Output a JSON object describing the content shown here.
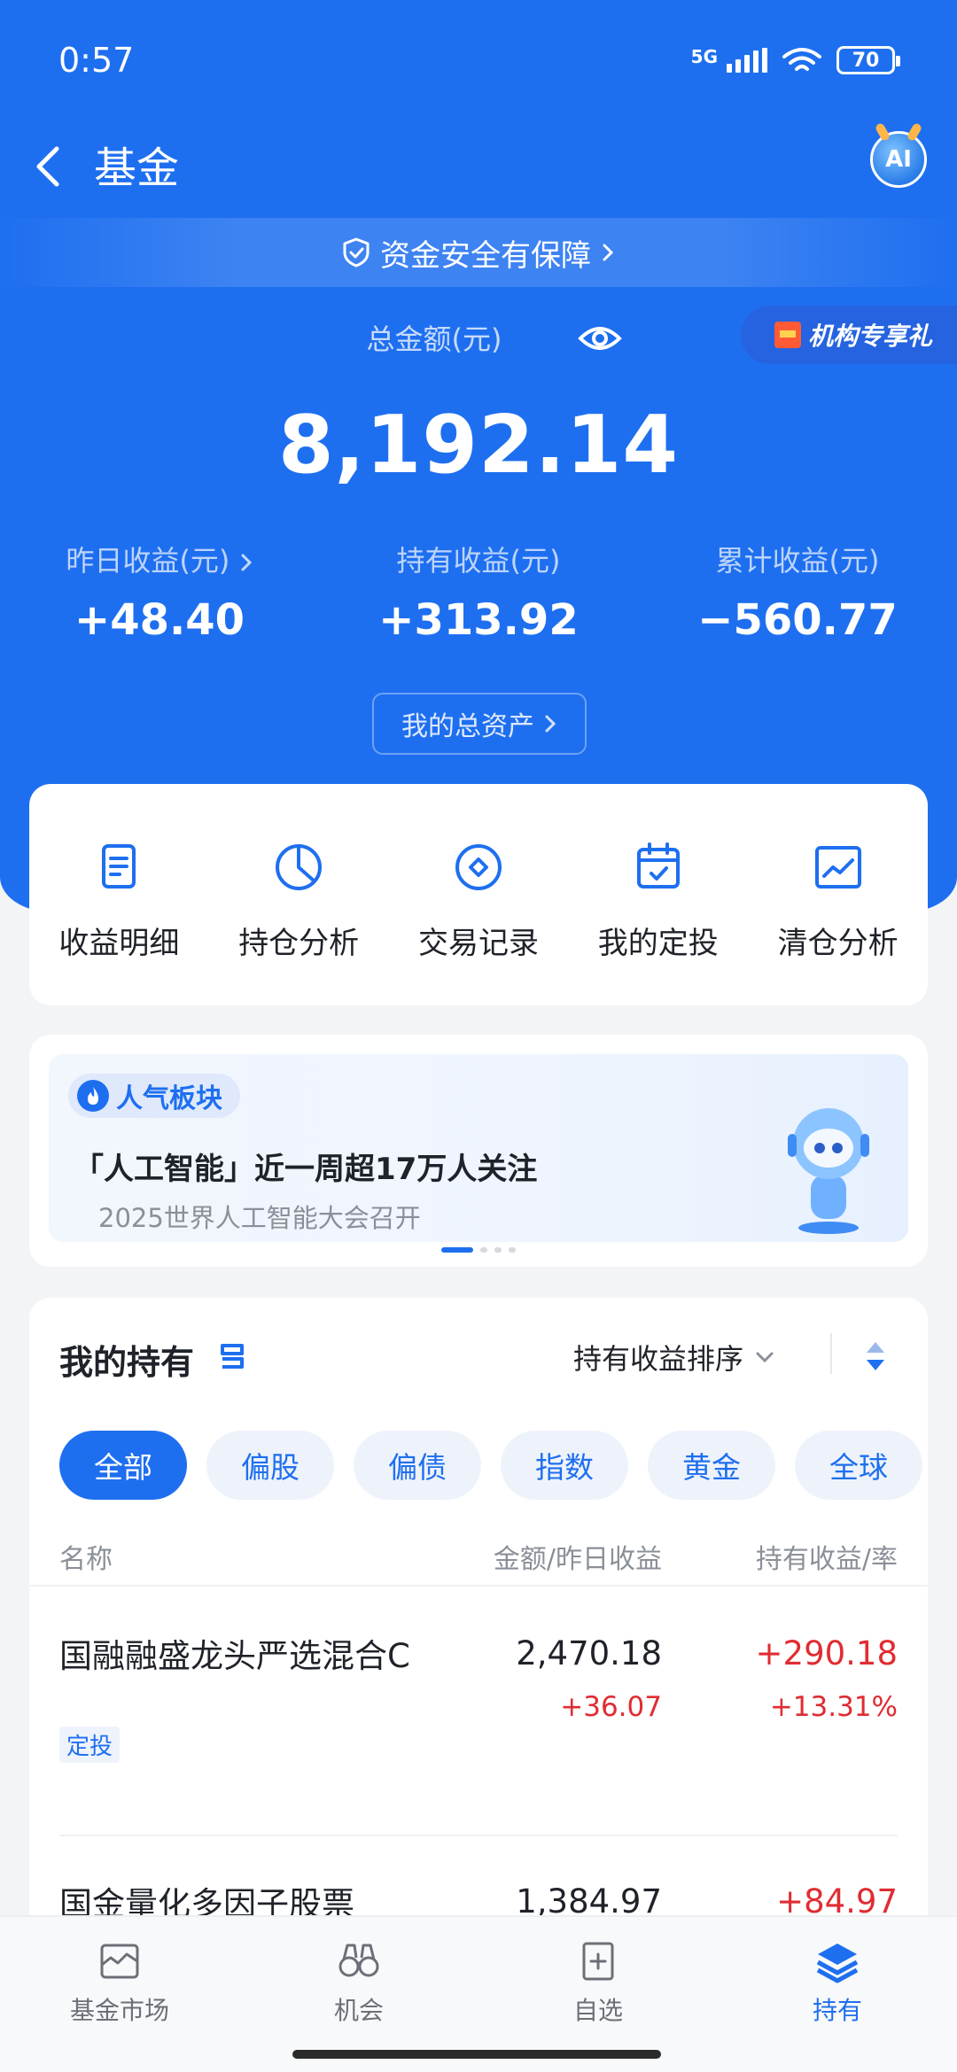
{
  "status_bar": {
    "time": "0:57",
    "network": "5G",
    "battery": "70"
  },
  "nav": {
    "title": "基金",
    "ai_label": "AI"
  },
  "security_banner": "资金安全有保障",
  "promo_tag": "机构专享礼",
  "summary": {
    "total_label": "总金额(元)",
    "total_amount": "8,192.14",
    "stats": [
      {
        "label": "昨日收益(元)",
        "value": "+48.40"
      },
      {
        "label": "持有收益(元)",
        "value": "+313.92"
      },
      {
        "label": "累计收益(元)",
        "value": "−560.77"
      }
    ],
    "total_assets_button": "我的总资产"
  },
  "shortcuts": [
    {
      "label": "收益明细",
      "icon": "document-icon"
    },
    {
      "label": "持仓分析",
      "icon": "pie-chart-icon"
    },
    {
      "label": "交易记录",
      "icon": "diamond-icon"
    },
    {
      "label": "我的定投",
      "icon": "calendar-check-icon"
    },
    {
      "label": "清仓分析",
      "icon": "trend-chart-icon"
    }
  ],
  "hot_topic": {
    "tag": "人气板块",
    "headline": "「人工智能」近一周超17万人关注",
    "subtitle": "2025世界人工智能大会召开"
  },
  "holdings": {
    "title": "我的持有",
    "sort_label": "持有收益排序",
    "filters": [
      "全部",
      "偏股",
      "偏债",
      "指数",
      "黄金",
      "全球"
    ],
    "columns": {
      "name": "名称",
      "amount": "金额/昨日收益",
      "holding": "持有收益/率"
    },
    "funds": [
      {
        "name": "国融融盛龙头严选混合C",
        "badge": "定投",
        "amount": "2,470.18",
        "yesterday": "+36.07",
        "holding_profit": "+290.18",
        "holding_rate": "+13.31%"
      },
      {
        "name": "国金量化多因子股票",
        "amount": "1,384.97",
        "holding_profit": "+84.97"
      }
    ]
  },
  "tabbar": [
    {
      "label": "基金市场",
      "icon": "market-icon"
    },
    {
      "label": "机会",
      "icon": "binoculars-icon"
    },
    {
      "label": "自选",
      "icon": "add-watchlist-icon"
    },
    {
      "label": "持有",
      "icon": "layers-icon"
    }
  ],
  "colors": {
    "brand_blue": "#1e6ff0",
    "profit_red": "#e02c32"
  }
}
